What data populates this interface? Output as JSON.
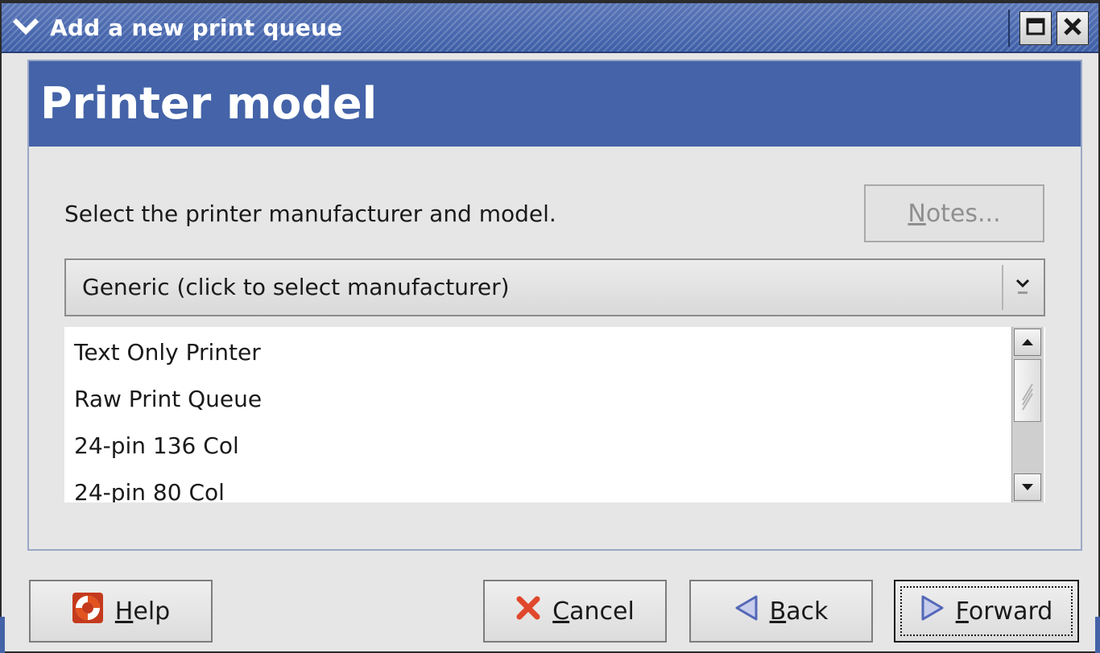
{
  "window": {
    "title": "Add a new print queue"
  },
  "header": {
    "title": "Printer model"
  },
  "main": {
    "instruction": "Select the printer manufacturer and model.",
    "notes_button": {
      "mnemonic": "N",
      "rest": "otes..."
    },
    "manufacturer_select": {
      "value": "Generic (click to select manufacturer)"
    },
    "models": [
      "Text Only Printer",
      "Raw Print Queue",
      "24-pin 136 Col",
      "24-pin 80 Col"
    ]
  },
  "buttons": {
    "help": {
      "mnemonic": "H",
      "rest": "elp"
    },
    "cancel": {
      "mnemonic": "C",
      "rest": "ancel"
    },
    "back": {
      "mnemonic": "B",
      "rest": "ack"
    },
    "forward": {
      "mnemonic": "F",
      "rest": "orward"
    }
  },
  "colors": {
    "titlebar": "#4463a8",
    "header": "#4463a8",
    "cancel_icon": "#e0482c",
    "nav_arrow": "#5468b8"
  },
  "icons": {
    "window_menu": "chevron-down-icon",
    "maximize": "maximize-icon",
    "close": "close-icon",
    "help": "lifebuoy-icon",
    "cancel": "x-icon",
    "back": "triangle-left-icon",
    "forward": "triangle-right-icon"
  }
}
